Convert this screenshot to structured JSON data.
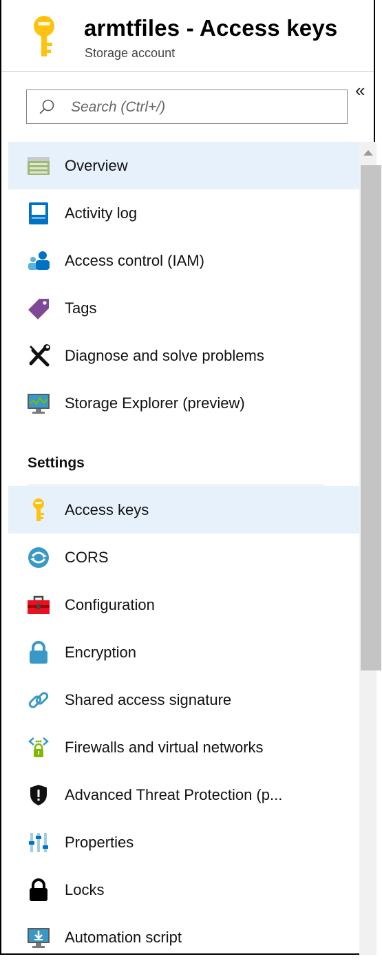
{
  "header": {
    "title": "armtfiles - Access keys",
    "subtitle": "Storage account",
    "icon": "key-icon",
    "accent": "#FFC20E"
  },
  "collapse_label": "«",
  "search": {
    "placeholder": "Search (Ctrl+/)",
    "value": ""
  },
  "menu": {
    "items": [
      {
        "label": "Overview",
        "icon": "overview-icon",
        "selected": true
      },
      {
        "label": "Activity log",
        "icon": "activity-log-icon"
      },
      {
        "label": "Access control (IAM)",
        "icon": "access-control-icon"
      },
      {
        "label": "Tags",
        "icon": "tag-icon"
      },
      {
        "label": "Diagnose and solve problems",
        "icon": "wrench-screwdriver-icon"
      },
      {
        "label": "Storage Explorer (preview)",
        "icon": "storage-explorer-icon"
      }
    ]
  },
  "settings": {
    "heading": "Settings",
    "items": [
      {
        "label": "Access keys",
        "icon": "key-icon",
        "selected": true
      },
      {
        "label": "CORS",
        "icon": "cors-icon"
      },
      {
        "label": "Configuration",
        "icon": "toolbox-icon"
      },
      {
        "label": "Encryption",
        "icon": "lock-icon"
      },
      {
        "label": "Shared access signature",
        "icon": "link-icon"
      },
      {
        "label": "Firewalls and virtual networks",
        "icon": "firewall-icon"
      },
      {
        "label": "Advanced Threat Protection (p...",
        "icon": "shield-icon"
      },
      {
        "label": "Properties",
        "icon": "properties-icon"
      },
      {
        "label": "Locks",
        "icon": "padlock-icon"
      },
      {
        "label": "Automation script",
        "icon": "automation-script-icon"
      }
    ]
  },
  "colors": {
    "selected_bg": "#E6F1FB",
    "key_yellow": "#FFC20E",
    "azure_blue": "#0072C6"
  }
}
